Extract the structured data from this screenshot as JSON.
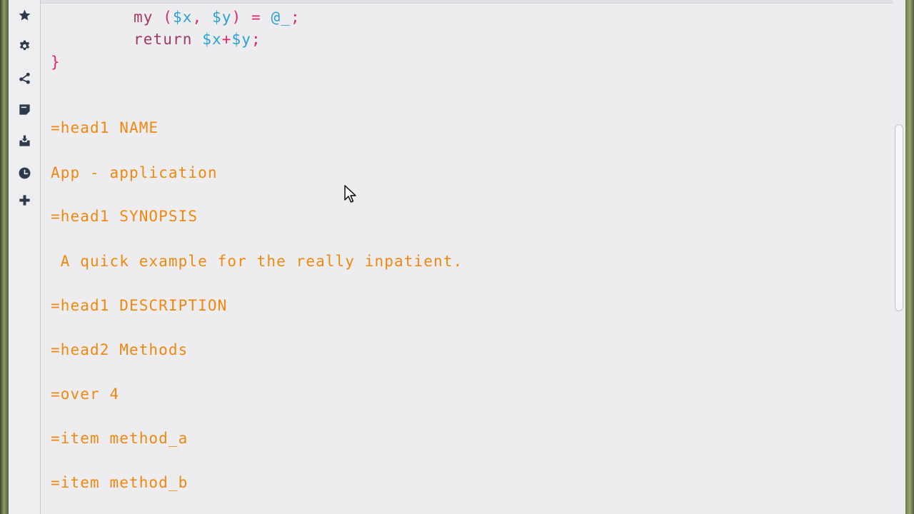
{
  "sidebar": {
    "items": [
      {
        "name": "star-icon"
      },
      {
        "name": "gear-icon"
      },
      {
        "name": "share-icon"
      },
      {
        "name": "note-icon"
      },
      {
        "name": "download-icon"
      },
      {
        "name": "clock-icon"
      },
      {
        "name": "plus-icon"
      }
    ]
  },
  "code": {
    "line_my_kw": "my",
    "line_my_open": "(",
    "line_my_x": "$x",
    "line_my_comma": ",",
    "line_my_y": "$y",
    "line_my_close": ")",
    "line_my_eq": "=",
    "line_my_args": "@_",
    "line_my_semi": ";",
    "line_return_kw": "return",
    "line_return_x": "$x",
    "line_return_plus": "+",
    "line_return_y": "$y",
    "line_return_semi": ";",
    "close_brace": "}"
  },
  "pod": [
    "=head1 NAME",
    "App - application",
    "=head1 SYNOPSIS",
    " A quick example for the really inpatient.",
    "=head1 DESCRIPTION",
    "=head2 Methods",
    "=over 4",
    "=item method_a",
    "=item method_b"
  ],
  "colors": {
    "pod_text": "#f0880f",
    "keyword": "#a13a60",
    "variable": "#2aa1d3",
    "operator": "#e4246b",
    "background": "#ededf0",
    "sidebar_icon": "#2c3a4e"
  }
}
